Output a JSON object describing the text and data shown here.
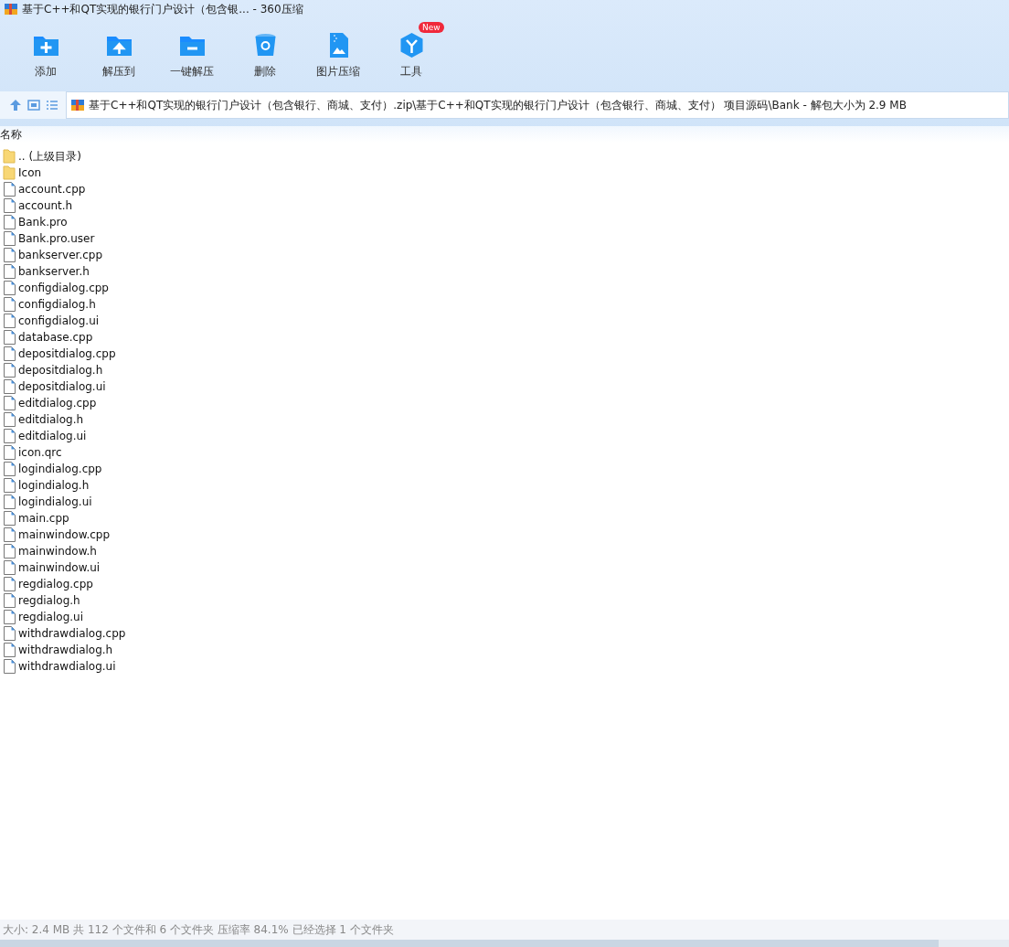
{
  "window": {
    "title": "基于C++和QT实现的银行门户设计（包含银... - 360压缩"
  },
  "toolbar": [
    {
      "kind": "add",
      "label": "添加"
    },
    {
      "kind": "extract-to",
      "label": "解压到"
    },
    {
      "kind": "one-click",
      "label": "一键解压"
    },
    {
      "kind": "delete",
      "label": "删除"
    },
    {
      "kind": "image",
      "label": "图片压缩"
    },
    {
      "kind": "tools",
      "label": "工具",
      "badge": "New"
    }
  ],
  "address_bar": {
    "path": "基于C++和QT实现的银行门户设计（包含银行、商城、支付）.zip\\基于C++和QT实现的银行门户设计（包含银行、商城、支付） 项目源码\\Bank - 解包大小为 2.9 MB"
  },
  "table": {
    "columns": [
      "名称"
    ],
    "rows": [
      {
        "kind": "folder",
        "name": ".. (上级目录)"
      },
      {
        "kind": "folder",
        "name": "Icon"
      },
      {
        "kind": "file",
        "name": "account.cpp"
      },
      {
        "kind": "file",
        "name": "account.h"
      },
      {
        "kind": "file",
        "name": "Bank.pro"
      },
      {
        "kind": "file",
        "name": "Bank.pro.user"
      },
      {
        "kind": "file",
        "name": "bankserver.cpp"
      },
      {
        "kind": "file",
        "name": "bankserver.h"
      },
      {
        "kind": "file",
        "name": "configdialog.cpp"
      },
      {
        "kind": "file",
        "name": "configdialog.h"
      },
      {
        "kind": "file",
        "name": "configdialog.ui"
      },
      {
        "kind": "file",
        "name": "database.cpp"
      },
      {
        "kind": "file",
        "name": "depositdialog.cpp"
      },
      {
        "kind": "file",
        "name": "depositdialog.h"
      },
      {
        "kind": "file",
        "name": "depositdialog.ui"
      },
      {
        "kind": "file",
        "name": "editdialog.cpp"
      },
      {
        "kind": "file",
        "name": "editdialog.h"
      },
      {
        "kind": "file",
        "name": "editdialog.ui"
      },
      {
        "kind": "file",
        "name": "icon.qrc"
      },
      {
        "kind": "file",
        "name": "logindialog.cpp"
      },
      {
        "kind": "file",
        "name": "logindialog.h"
      },
      {
        "kind": "file",
        "name": "logindialog.ui"
      },
      {
        "kind": "file",
        "name": "main.cpp"
      },
      {
        "kind": "file",
        "name": "mainwindow.cpp"
      },
      {
        "kind": "file",
        "name": "mainwindow.h"
      },
      {
        "kind": "file",
        "name": "mainwindow.ui"
      },
      {
        "kind": "file",
        "name": "regdialog.cpp"
      },
      {
        "kind": "file",
        "name": "regdialog.h"
      },
      {
        "kind": "file",
        "name": "regdialog.ui"
      },
      {
        "kind": "file",
        "name": "withdrawdialog.cpp"
      },
      {
        "kind": "file",
        "name": "withdrawdialog.h"
      },
      {
        "kind": "file",
        "name": "withdrawdialog.ui"
      }
    ]
  },
  "status_bar": {
    "text": "大小: 2.4 MB 共 112 个文件和 6 个文件夹 压缩率 84.1% 已经选择 1 个文件夹"
  }
}
